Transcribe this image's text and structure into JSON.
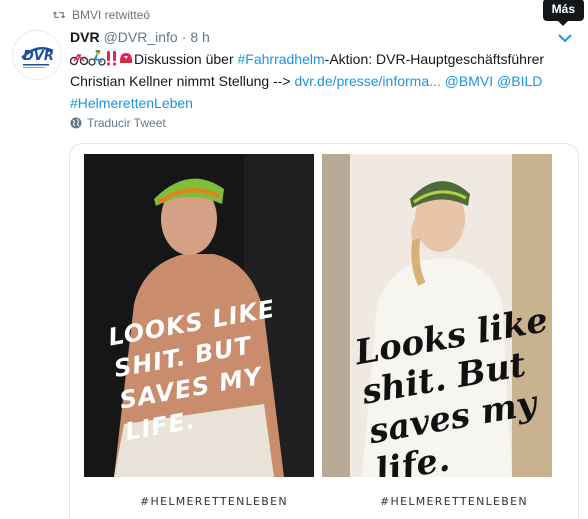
{
  "retweet": {
    "text": "BMVI retwitteó"
  },
  "tooltip": {
    "label": "Más"
  },
  "tweet": {
    "name": "DVR",
    "handle": "@DVR_info",
    "separator": "·",
    "time": "8 h",
    "text": {
      "part1": "Diskussion über ",
      "hashtag1": "#Fahrradhelm",
      "part2": "-Aktion: DVR-Hauptgeschäftsführer Christian Kellner nimmt Stellung  --> ",
      "link": "dvr.de/presse/informa...",
      "mention1": "@BMVI",
      "mention2": "@BILD",
      "hashtag2": "#HelmerettenLeben"
    },
    "translate_label": "Traducir Tweet"
  },
  "media": {
    "left": {
      "slogan": "LOOKS LIKE SHIT. BUT SAVES MY LIFE.",
      "hashtag": "#HELMERETTENLEBEN"
    },
    "right": {
      "slogan": "Looks like shit. But saves my life.",
      "hashtag": "#HELMERETTENLEBEN"
    }
  },
  "colors": {
    "link": "#1b95e0",
    "muted": "#657786",
    "text": "#14171a",
    "avatar_blue": "#1f4e9c"
  },
  "icons": [
    "retweet-icon",
    "chevron-down-icon",
    "bicycle-emoji",
    "cyclist-emoji",
    "double-exclamation-emoji",
    "helmet-emoji",
    "globe-icon"
  ]
}
